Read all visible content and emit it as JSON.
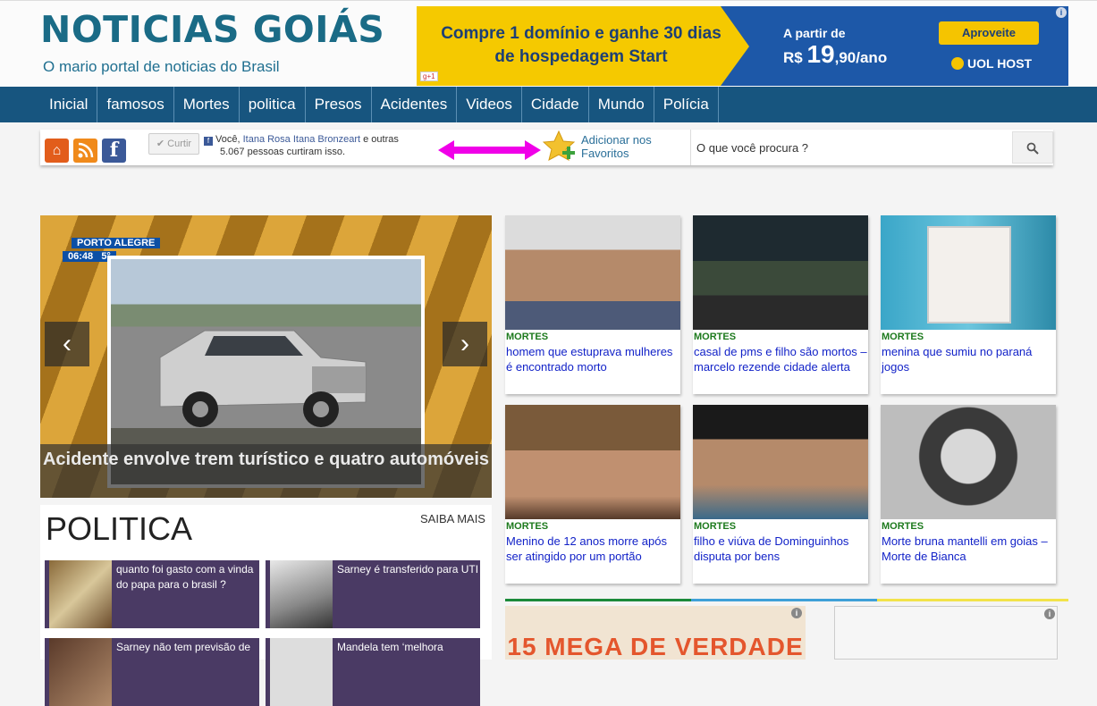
{
  "header": {
    "logo_title": "NOTICIAS GOIÁS",
    "logo_subtitle": "O mario portal de noticias do Brasil"
  },
  "top_ad": {
    "headline_line1": "Compre 1 domínio e ganhe 30 dias",
    "headline_line2": "de hospedagem Start",
    "price_label": "A partir de",
    "price_currency": "R$",
    "price_whole": "19",
    "price_rest": ",90/ano",
    "button_label": "Aproveite",
    "brand": "UOL HOST",
    "gplus": "g+1",
    "info": "i"
  },
  "nav": {
    "items": [
      "Inicial",
      "famosos",
      "Mortes",
      "politica",
      "Presos",
      "Acidentes",
      "Videos",
      "Cidade",
      "Mundo",
      "Polícia"
    ]
  },
  "toolbar": {
    "like_label": "✔ Curtir",
    "fb_prefix": "Você,",
    "fb_names": "Itana Rosa Itana Bronzeart",
    "fb_suffix": "e outras",
    "fb_line2": "5.067 pessoas curtiram isso.",
    "favorites_line1": "Adicionar nos",
    "favorites_line2": "Favoritos",
    "search_placeholder": "O que você procura ?"
  },
  "slider": {
    "tv_city": "PORTO ALEGRE",
    "tv_time": "06:48",
    "tv_temp": "5°",
    "caption": "Acidente envolve trem turístico e quatro automóveis",
    "prev": "‹",
    "next": "›"
  },
  "politica": {
    "title": "POLITICA",
    "more": "SAIBA MAIS",
    "items": [
      {
        "text": "quanto foi gasto com a vinda do papa para o brasil ?"
      },
      {
        "text": "Sarney é transferido para UTI"
      },
      {
        "text": "Sarney não tem previsão de"
      },
      {
        "text": "Mandela tem ‘melhora"
      }
    ]
  },
  "articles": [
    {
      "category": "MORTES",
      "title": " homem que estuprava mulheres é encontrado morto"
    },
    {
      "category": "MORTES",
      "title": " casal de pms e filho são mortos – marcelo rezende cidade alerta"
    },
    {
      "category": "MORTES",
      "title": " menina que sumiu no paraná jogos"
    },
    {
      "category": "MORTES",
      "title": " Menino de 12 anos morre após ser atingido por um portão"
    },
    {
      "category": "MORTES",
      "title": " filho e viúva de Dominguinhos disputa por bens"
    },
    {
      "category": "MORTES",
      "title": " Morte bruna mantelli em goias – Morte de Bianca"
    }
  ],
  "bottom_ad": {
    "text": "15 MEGA DE VERDADE"
  }
}
